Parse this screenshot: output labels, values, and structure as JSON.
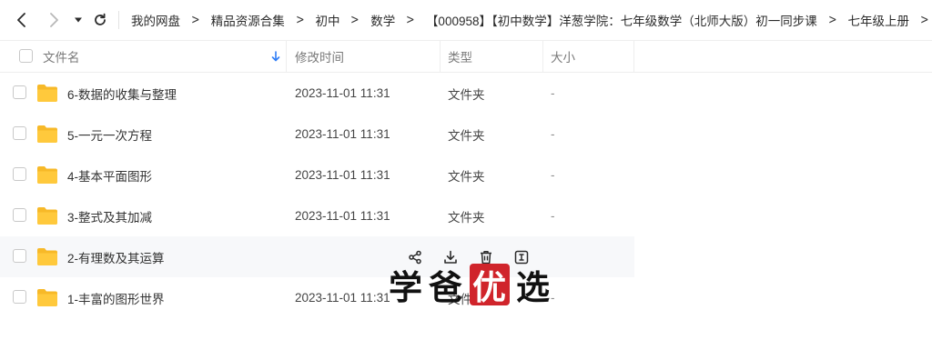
{
  "nav": {
    "back_icon": "chevron-left-icon",
    "forward_icon": "chevron-right-icon",
    "history_icon": "caret-down-icon",
    "refresh_icon": "refresh-icon"
  },
  "breadcrumb": [
    "我的网盘",
    "精品资源合集",
    "初中",
    "数学",
    "【000958】【初中数学】洋葱学院：七年级数学（北师大版）初一同步课",
    "七年级上册"
  ],
  "breadcrumb_sep": ">",
  "columns": {
    "name": "文件名",
    "modified": "修改时间",
    "type": "类型",
    "size": "大小",
    "sort_icon": "sort-arrow-down-icon"
  },
  "files": [
    {
      "name": "6-数据的收集与整理",
      "modified": "2023-11-01 11:31",
      "type": "文件夹",
      "size": "-"
    },
    {
      "name": "5-一元一次方程",
      "modified": "2023-11-01 11:31",
      "type": "文件夹",
      "size": "-"
    },
    {
      "name": "4-基本平面图形",
      "modified": "2023-11-01 11:31",
      "type": "文件夹",
      "size": "-"
    },
    {
      "name": "3-整式及其加减",
      "modified": "2023-11-01 11:31",
      "type": "文件夹",
      "size": "-"
    },
    {
      "name": "2-有理数及其运算",
      "modified": "",
      "type": "",
      "size": ""
    },
    {
      "name": "1-丰富的图形世界",
      "modified": "2023-11-01 11:31",
      "type": "文件夹",
      "size": "-"
    }
  ],
  "row_actions": [
    "share-icon",
    "download-icon",
    "delete-icon",
    "rename-icon"
  ],
  "watermark": {
    "c1": "学",
    "c2": "爸",
    "c3": "优",
    "c4": "选"
  },
  "colors": {
    "folder": "#ffc93c",
    "accent": "#2f7df6",
    "stamp": "#d0242b"
  }
}
